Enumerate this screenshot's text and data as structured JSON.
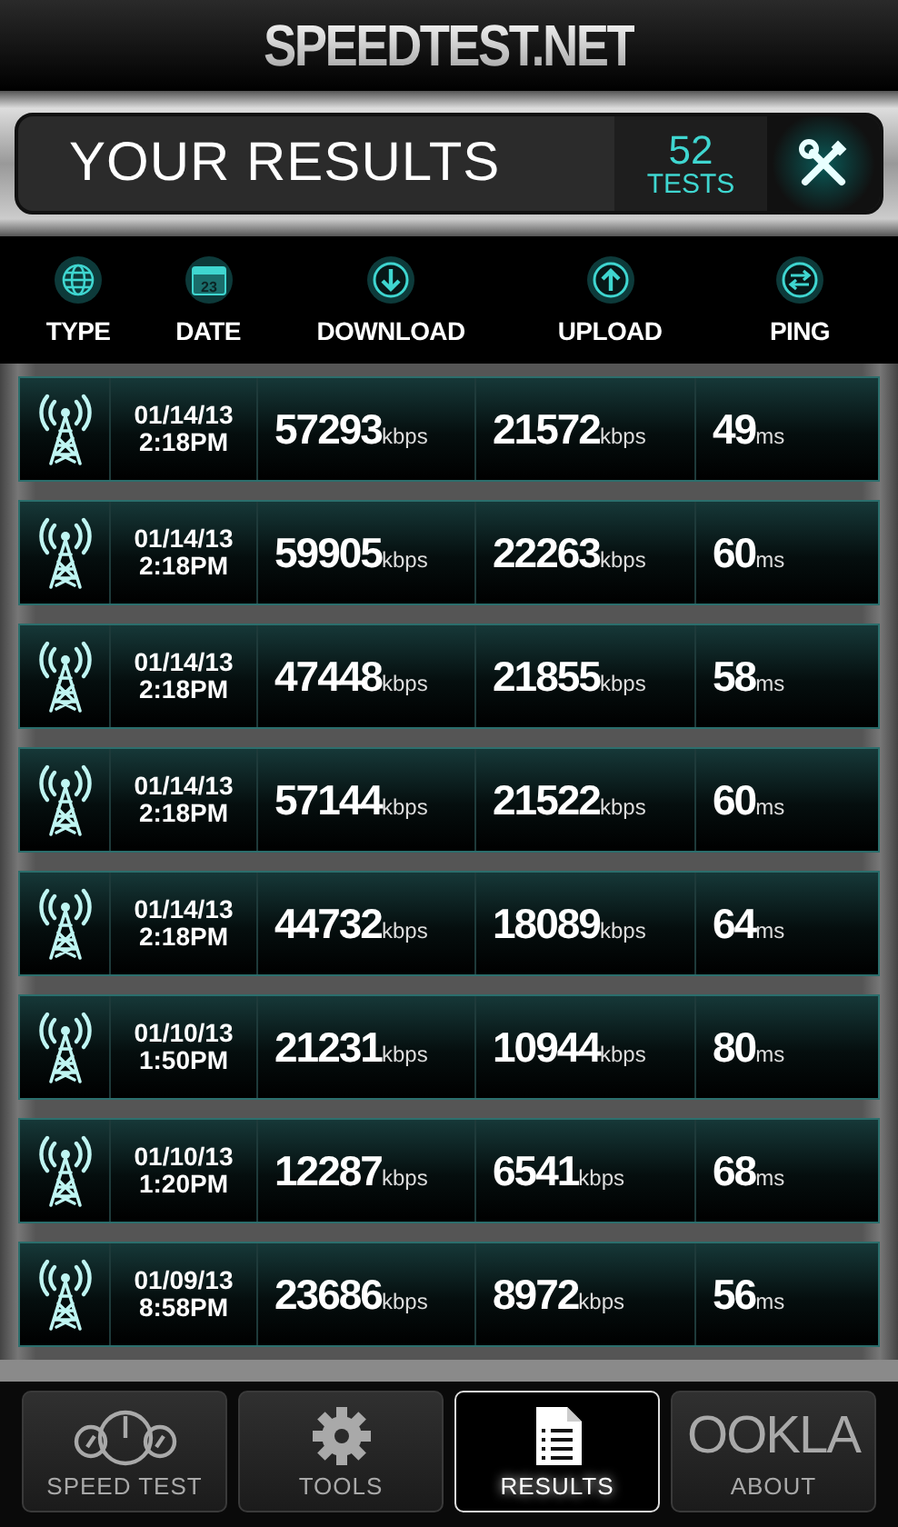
{
  "app_title": "SPEEDTEST.NET",
  "results_bar": {
    "title": "YOUR RESULTS",
    "count": "52",
    "count_label": "TESTS"
  },
  "columns": [
    {
      "label": "TYPE",
      "kind": "globe"
    },
    {
      "label": "DATE",
      "kind": "calendar",
      "icon_text": "23"
    },
    {
      "label": "DOWNLOAD",
      "kind": "download"
    },
    {
      "label": "UPLOAD",
      "kind": "upload"
    },
    {
      "label": "PING",
      "kind": "ping"
    }
  ],
  "rows": [
    {
      "kind": "cellular",
      "date": "01/14/13",
      "time": "2:18PM",
      "download": "57293",
      "download_unit": "kbps",
      "upload": "21572",
      "upload_unit": "kbps",
      "ping": "49",
      "ping_unit": "ms"
    },
    {
      "kind": "cellular",
      "date": "01/14/13",
      "time": "2:18PM",
      "download": "59905",
      "download_unit": "kbps",
      "upload": "22263",
      "upload_unit": "kbps",
      "ping": "60",
      "ping_unit": "ms"
    },
    {
      "kind": "cellular",
      "date": "01/14/13",
      "time": "2:18PM",
      "download": "47448",
      "download_unit": "kbps",
      "upload": "21855",
      "upload_unit": "kbps",
      "ping": "58",
      "ping_unit": "ms"
    },
    {
      "kind": "cellular",
      "date": "01/14/13",
      "time": "2:18PM",
      "download": "57144",
      "download_unit": "kbps",
      "upload": "21522",
      "upload_unit": "kbps",
      "ping": "60",
      "ping_unit": "ms"
    },
    {
      "kind": "cellular",
      "date": "01/14/13",
      "time": "2:18PM",
      "download": "44732",
      "download_unit": "kbps",
      "upload": "18089",
      "upload_unit": "kbps",
      "ping": "64",
      "ping_unit": "ms"
    },
    {
      "kind": "cellular",
      "date": "01/10/13",
      "time": "1:50PM",
      "download": "21231",
      "download_unit": "kbps",
      "upload": "10944",
      "upload_unit": "kbps",
      "ping": "80",
      "ping_unit": "ms"
    },
    {
      "kind": "cellular",
      "date": "01/10/13",
      "time": "1:20PM",
      "download": "12287",
      "download_unit": "kbps",
      "upload": "6541",
      "upload_unit": "kbps",
      "ping": "68",
      "ping_unit": "ms"
    },
    {
      "kind": "cellular",
      "date": "01/09/13",
      "time": "8:58PM",
      "download": "23686",
      "download_unit": "kbps",
      "upload": "8972",
      "upload_unit": "kbps",
      "ping": "56",
      "ping_unit": "ms"
    }
  ],
  "nav": [
    {
      "label": "SPEED TEST",
      "kind": "gauges",
      "selected": false
    },
    {
      "label": "TOOLS",
      "kind": "gear",
      "selected": false
    },
    {
      "label": "RESULTS",
      "kind": "document",
      "selected": true
    },
    {
      "label": "ABOUT",
      "kind": "logo",
      "logo_text": "OOKLA",
      "selected": false
    }
  ]
}
